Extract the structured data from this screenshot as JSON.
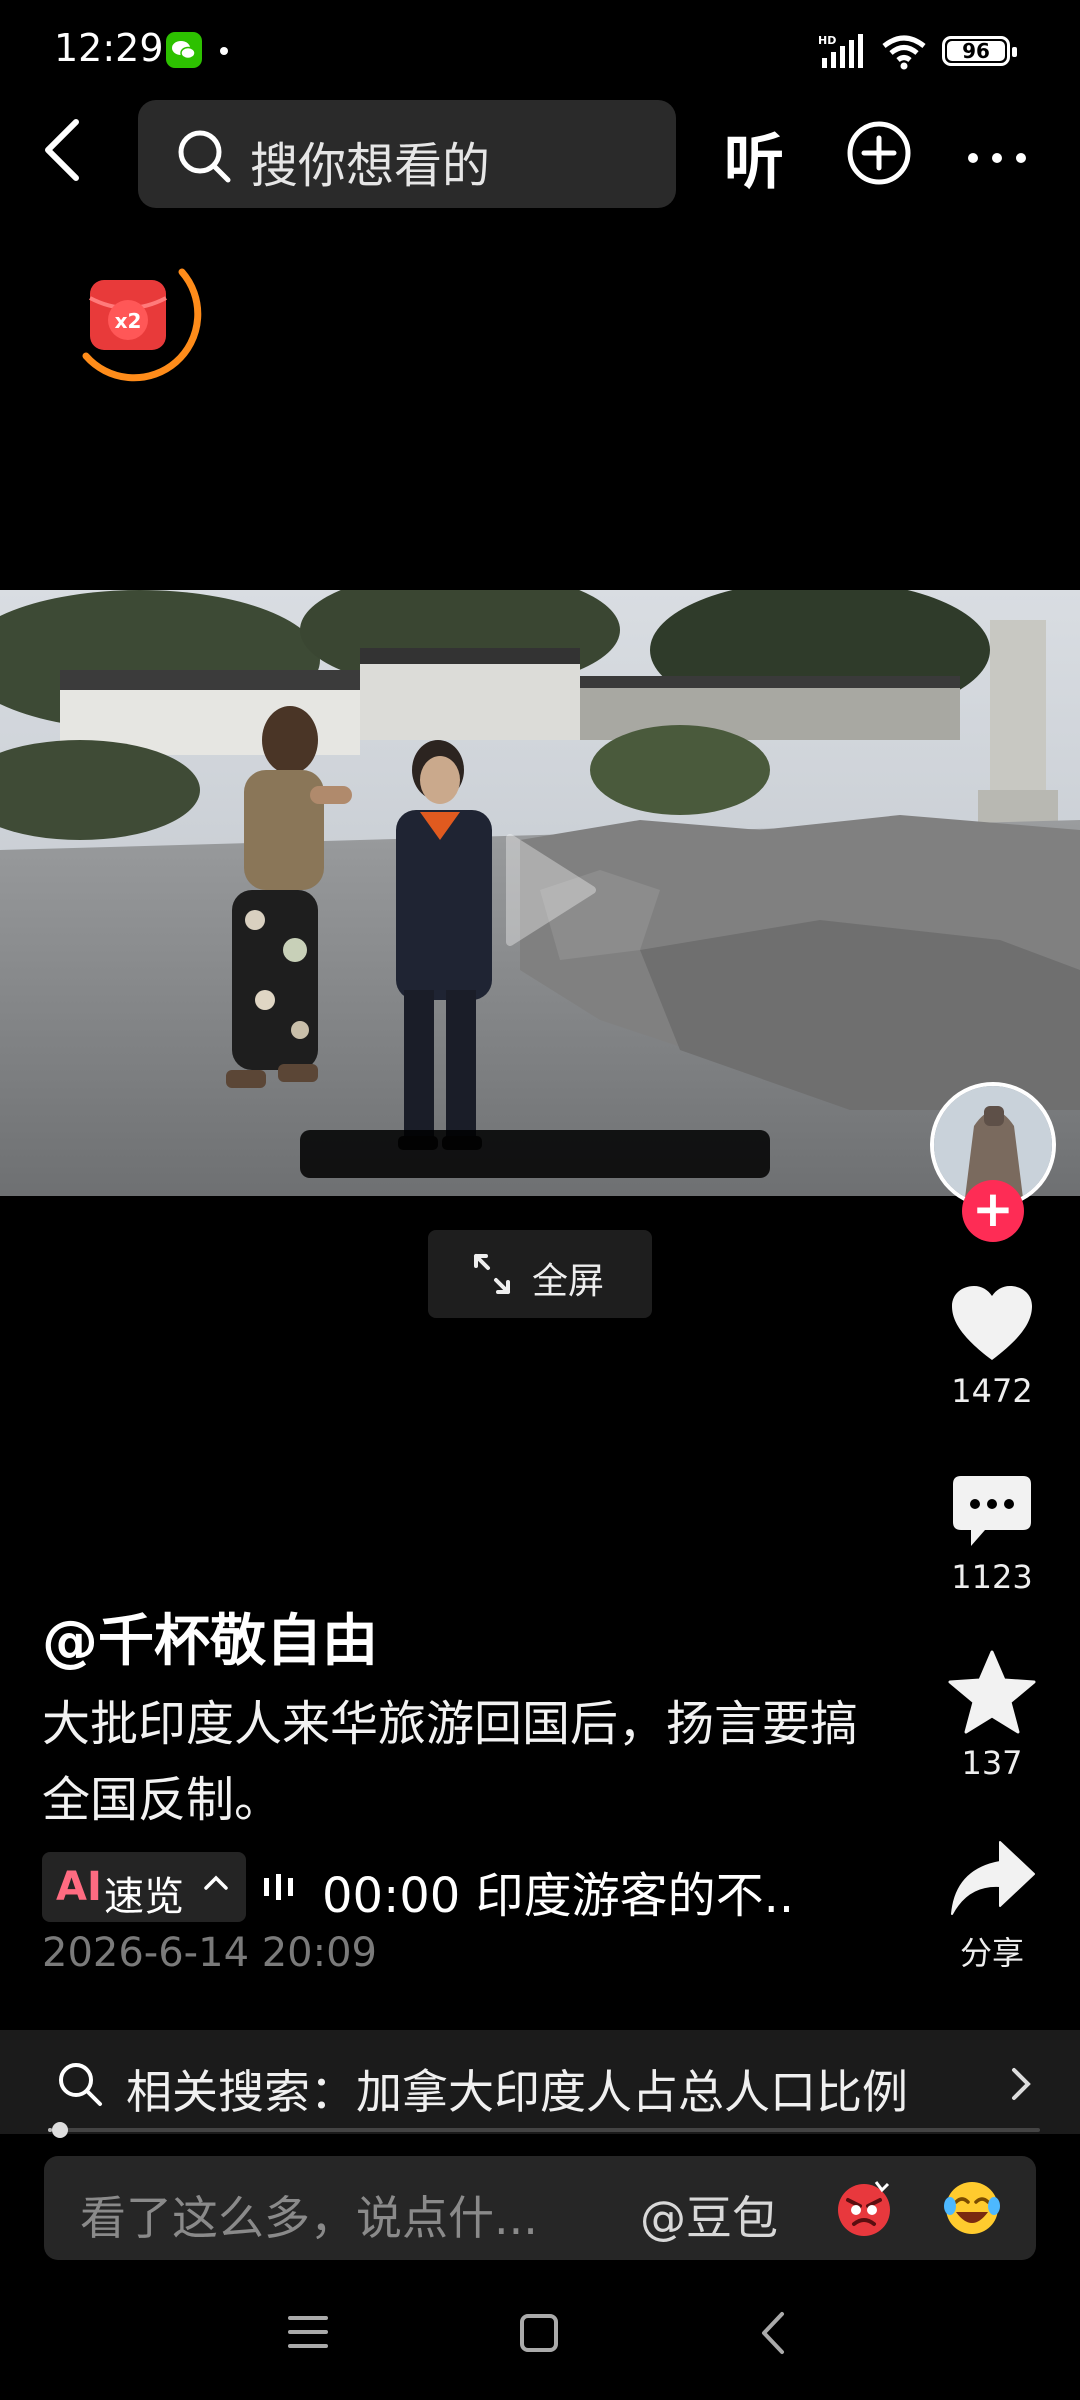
{
  "status_bar": {
    "time": "12:29",
    "battery": "96",
    "network": "HD"
  },
  "header": {
    "search_placeholder": "搜你想看的",
    "listen_label": "听"
  },
  "bonus": {
    "multiplier": "x2"
  },
  "video": {
    "fullscreen_label": "全屏"
  },
  "actions": {
    "likes": "1472",
    "comments": "1123",
    "favorites": "137",
    "share_label": "分享"
  },
  "post": {
    "author": "@千杯敬自由",
    "caption": "大批印度人来华旅游回国后，扬言要搞全国反制。",
    "ai_badge": "AI",
    "ai_label": "速览",
    "ai_summary": "00:00 印度游客的不..",
    "date": "2026-6-14 20:09"
  },
  "related_search": {
    "text": "相关搜索：加拿大印度人占总人口比例"
  },
  "playback": {
    "progress": 0.004
  },
  "comment_box": {
    "placeholder": "看了这么多，说点什...",
    "mention": "@豆包"
  },
  "colors": {
    "accent": "#fe2c55",
    "bonus_ring": "#ff8c1a",
    "ai_badge": "#ff6b81"
  }
}
